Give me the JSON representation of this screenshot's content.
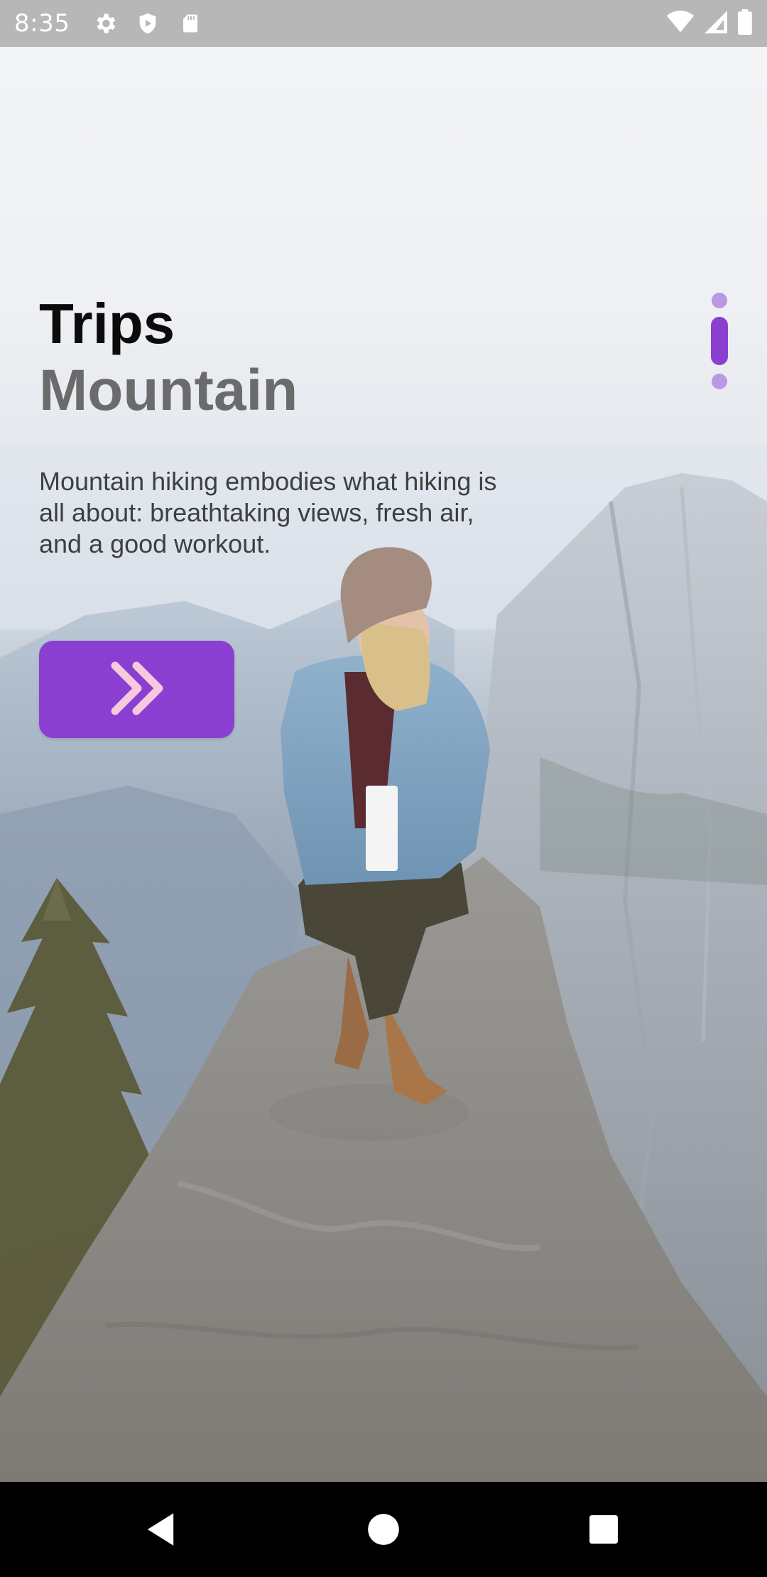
{
  "status_bar": {
    "time": "8:35",
    "left_icons": [
      "settings-icon",
      "shield-icon",
      "sd-card-icon"
    ],
    "right_icons": [
      "wifi-icon",
      "signal-icon",
      "battery-icon"
    ]
  },
  "content": {
    "title": "Trips",
    "subtitle": "Mountain",
    "description": "Mountain hiking embodies what hiking is all about: breathtaking views, fresh air, and a good workout."
  },
  "next_button": {
    "icon": "double-chevron-right-icon"
  },
  "page_indicator": {
    "count": 3,
    "active_index": 1
  },
  "colors": {
    "accent": "#8a3fd1",
    "accent_light": "#b998e4",
    "chevron": "#f6c9dd",
    "title": "#0b0b0b",
    "subtitle": "#6b6b6b",
    "status_bar": "#b7b7b7"
  },
  "nav_bar": {
    "buttons": [
      "back-icon",
      "home-icon",
      "recents-icon"
    ]
  }
}
